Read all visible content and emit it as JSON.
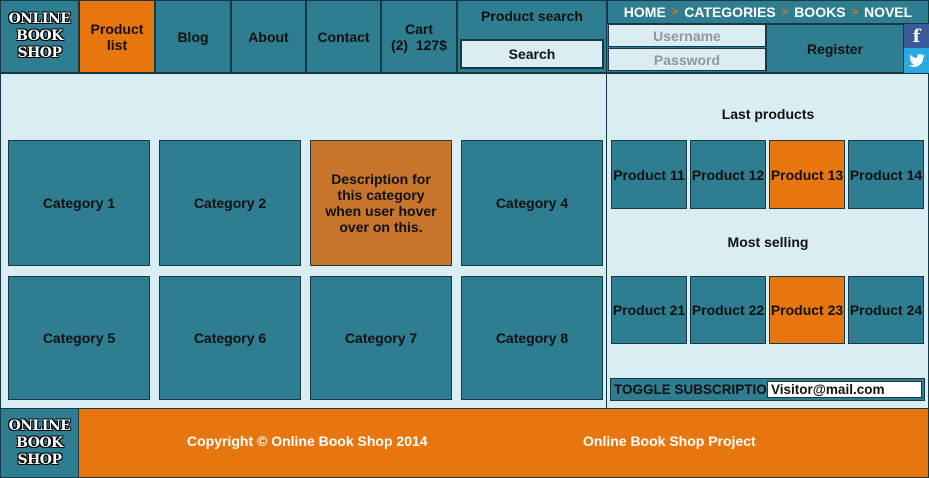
{
  "logo": {
    "line1": "ONLINE",
    "line2": "BOOK",
    "line3": "SHOP"
  },
  "nav": {
    "product_list_line1": "Product",
    "product_list_line2": "list",
    "blog": "Blog",
    "about": "About",
    "contact": "Contact",
    "cart_label": "Cart",
    "cart_summary": "(2)  127$"
  },
  "search": {
    "label": "Product search",
    "button": "Search"
  },
  "breadcrumb": {
    "home": "HOME",
    "categories": "CATEGORIES",
    "books": "BOOKS",
    "novel": "NOVEL",
    "separator": ">"
  },
  "login": {
    "username_placeholder": "Username",
    "password_placeholder": "Password",
    "register": "Register"
  },
  "social": {
    "facebook_glyph": "f",
    "twitter_glyph": "🐦"
  },
  "categories": [
    "Category 1",
    "Category 2",
    "Description for this category when user hover over on this.",
    "Category 4",
    "Category 5",
    "Category 6",
    "Category 7",
    "Category 8"
  ],
  "last_products": {
    "title": "Last products",
    "items": [
      "Product 11",
      "Product 12",
      "Product 13",
      "Product 14"
    ]
  },
  "most_selling": {
    "title": "Most selling",
    "items": [
      "Product 21",
      "Product 22",
      "Product 23",
      "Product 24"
    ]
  },
  "subscription": {
    "label": "TOGGLE SUBSCRIPTION",
    "email": "Visitor@mail.com"
  },
  "footer": {
    "copyright": "Copyright © Online Book Shop 2014",
    "project": "Online Book Shop Project"
  },
  "colors": {
    "teal": "#2e7d91",
    "orange": "#e8760f",
    "hover_orange": "#c6752a",
    "panel_bg": "#d9edf2"
  }
}
